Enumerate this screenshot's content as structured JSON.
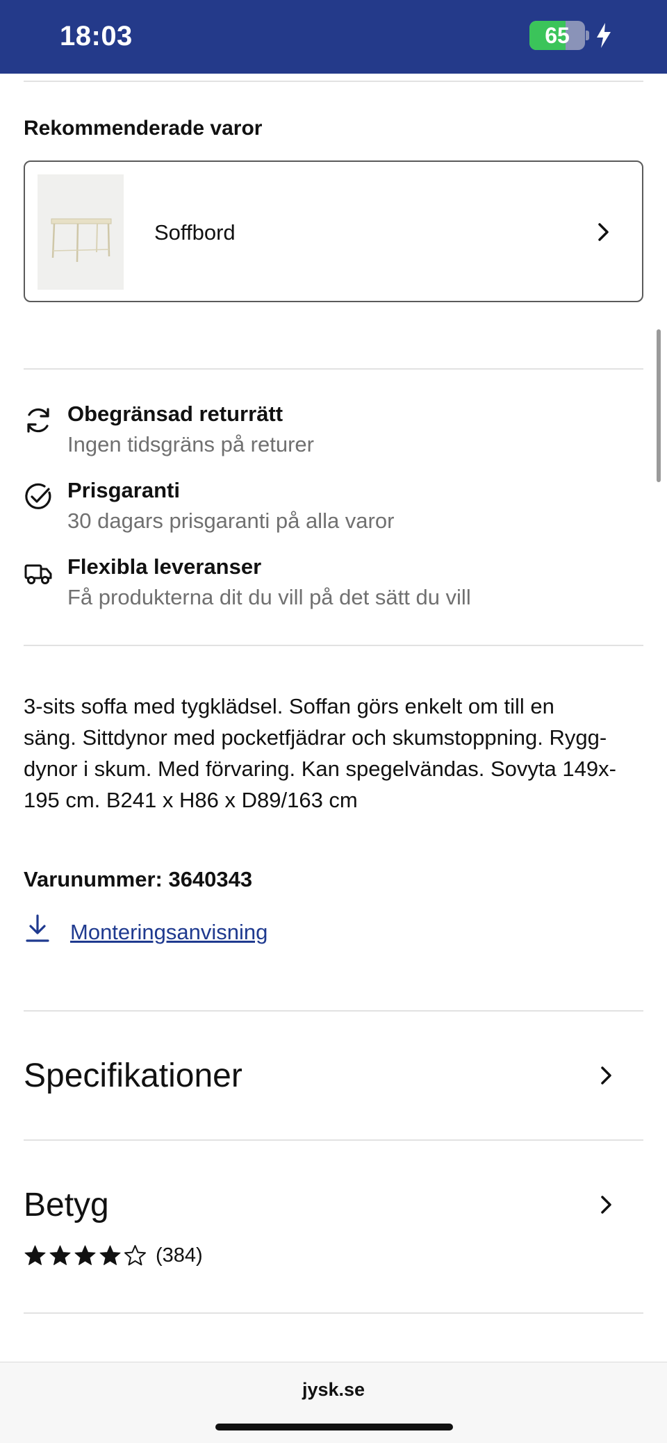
{
  "status_bar": {
    "time": "18:03",
    "battery_level": "65",
    "battery_fraction": 0.65,
    "background_color": "#243a8a"
  },
  "recommended": {
    "heading": "Rekommenderade varor",
    "items": [
      {
        "label": "Soffbord",
        "icon": "chevron-right-icon"
      }
    ]
  },
  "usps": [
    {
      "icon": "refresh-icon",
      "title": "Obegränsad returrätt",
      "subtitle": "Ingen tidsgräns på returer"
    },
    {
      "icon": "check-circle-icon",
      "title": "Prisgaranti",
      "subtitle": "30 dagars prisgaranti på alla varor"
    },
    {
      "icon": "truck-icon",
      "title": "Flexibla leveranser",
      "subtitle": "Få produkterna dit du vill på det sätt du vill"
    }
  ],
  "description": {
    "lines": [
      "3-sits soffa med tygklädsel. Soffan görs enkelt om till en",
      "säng. Sittdynor med pocketfjädrar och skumstoppning. Rygg-",
      "dynor i skum. Med förvaring. Kan spegelvändas. Sovyta 149x-",
      "195 cm. B241 x H86 x D89/163 cm"
    ]
  },
  "item_number": "Varunummer: 3640343",
  "manual_link": {
    "label": "Monteringsanvisning",
    "icon": "download-icon"
  },
  "accordions": {
    "specifications": {
      "title": "Specifikationer"
    },
    "rating": {
      "title": "Betyg",
      "stars": 4,
      "max_stars": 5,
      "count": "(384)"
    }
  },
  "browser": {
    "url": "jysk.se"
  },
  "colors": {
    "link": "#1f3a8f",
    "subtext": "#707070",
    "battery_green": "#3bc45a"
  }
}
